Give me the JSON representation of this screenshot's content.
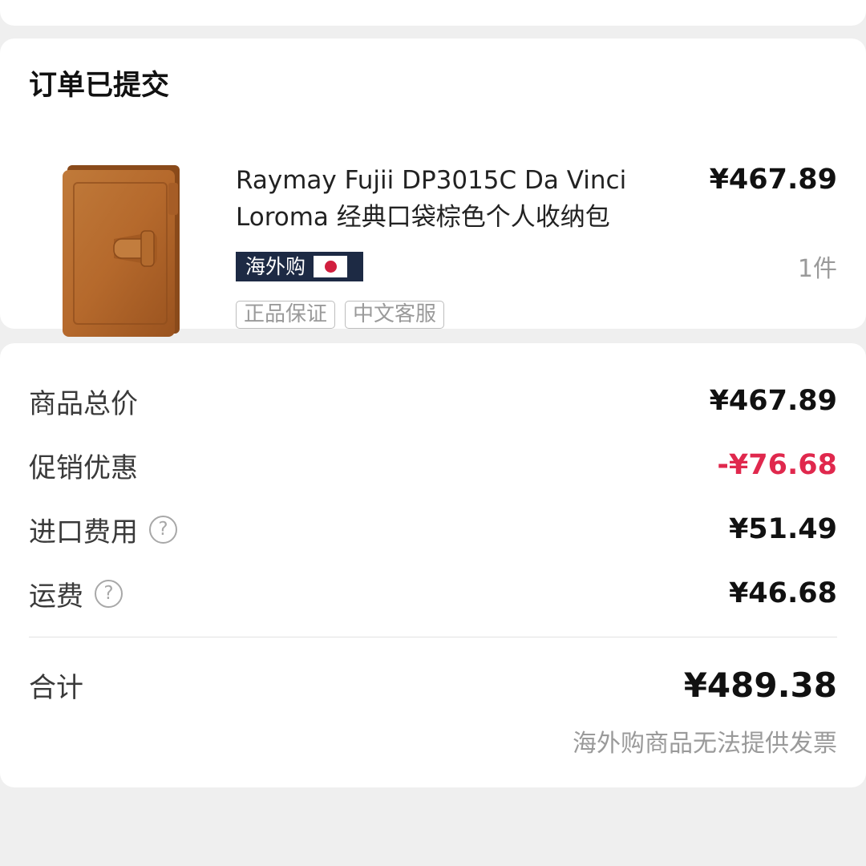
{
  "order": {
    "title": "订单已提交",
    "product": {
      "name": "Raymay Fujii DP3015C Da Vinci Loroma 经典口袋棕色个人收纳包",
      "price": "¥467.89",
      "quantity": "1件",
      "badge_label": "海外购",
      "badge_flag": "japan-flag-icon",
      "tags": [
        "正品保证",
        "中文客服"
      ],
      "image": "brown-leather-planner"
    }
  },
  "summary": {
    "rows": [
      {
        "label": "商品总价",
        "value": "¥467.89",
        "help": false
      },
      {
        "label": "促销优惠",
        "value": "-¥76.68",
        "help": false
      },
      {
        "label": "进口费用",
        "value": "¥51.49",
        "help": true
      },
      {
        "label": "运费",
        "value": "¥46.68",
        "help": true
      }
    ],
    "help_glyph": "?",
    "total_label": "合计",
    "total_value": "¥489.38",
    "invoice_note": "海外购商品无法提供发票"
  },
  "colors": {
    "discount": "#e0284d",
    "badge_bg": "#1d2a44",
    "leather": "#b5692c"
  }
}
